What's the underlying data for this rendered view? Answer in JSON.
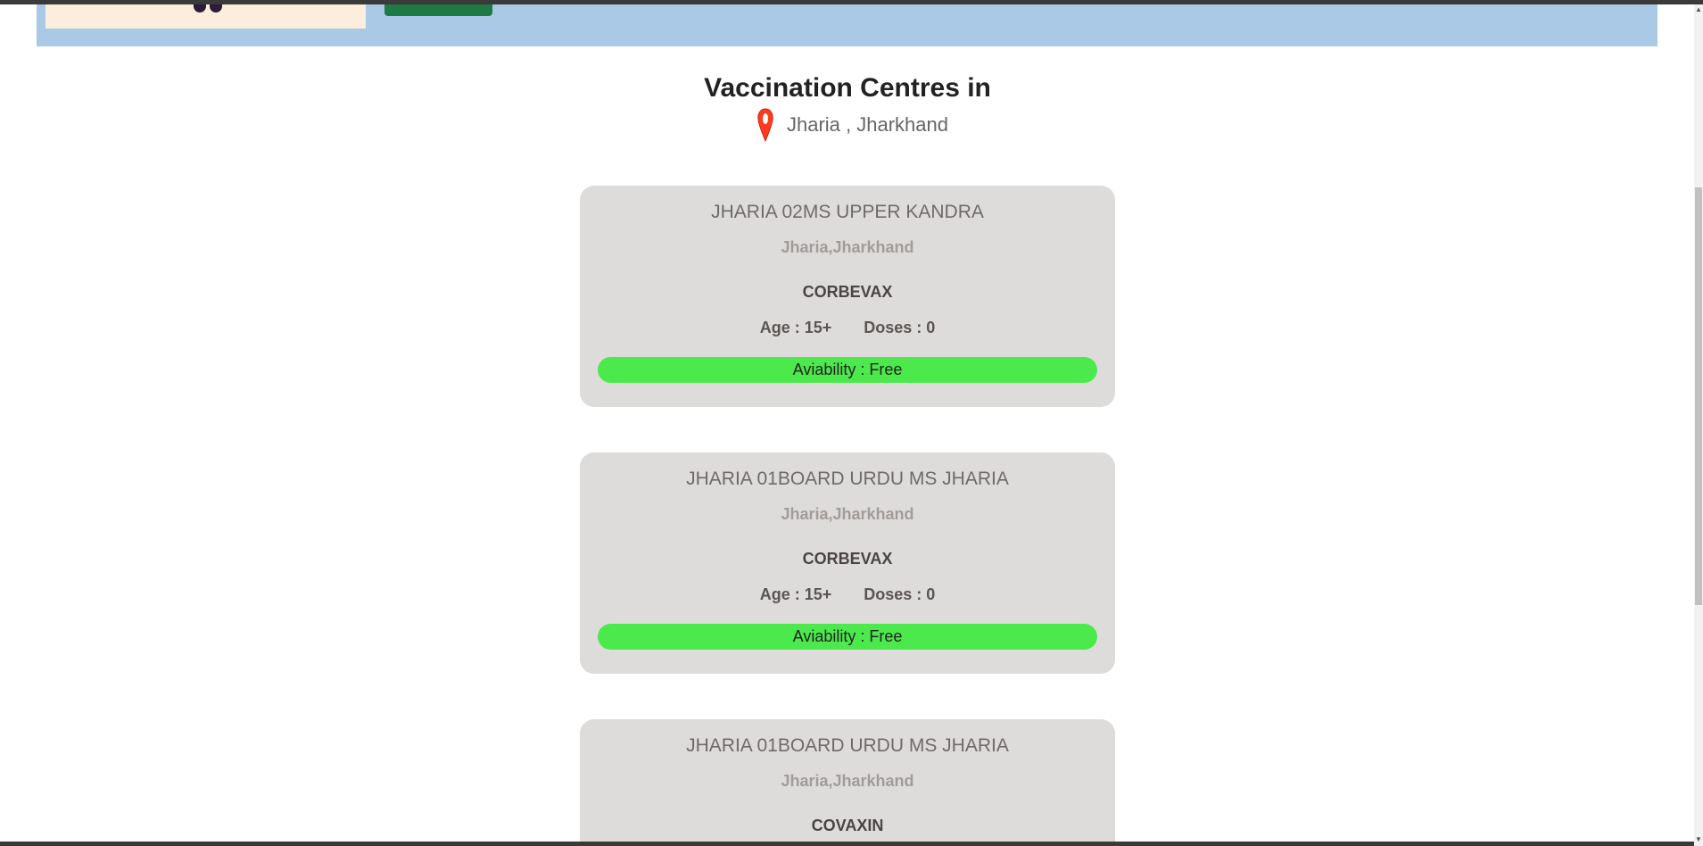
{
  "page": {
    "heading": "Vaccination Centres in",
    "location": "Jharia , Jharkhand",
    "icons": {
      "location": "map-pin-icon"
    },
    "colors": {
      "header_band": "#a9c9e6",
      "card_bg": "#dedcdb",
      "availability_green": "#4ce94c",
      "pin_red": "#ff3b1f"
    }
  },
  "centres": [
    {
      "name": "JHARIA 02MS UPPER KANDRA",
      "address": "Jharia,Jharkhand",
      "vaccine": "CORBEVAX",
      "age": "Age : 15+",
      "doses": "Doses : 0",
      "availability": "Aviability : Free"
    },
    {
      "name": "JHARIA 01BOARD URDU MS JHARIA",
      "address": "Jharia,Jharkhand",
      "vaccine": "CORBEVAX",
      "age": "Age : 15+",
      "doses": "Doses : 0",
      "availability": "Aviability : Free"
    },
    {
      "name": "JHARIA 01BOARD URDU MS JHARIA",
      "address": "Jharia,Jharkhand",
      "vaccine": "COVAXIN"
    }
  ]
}
